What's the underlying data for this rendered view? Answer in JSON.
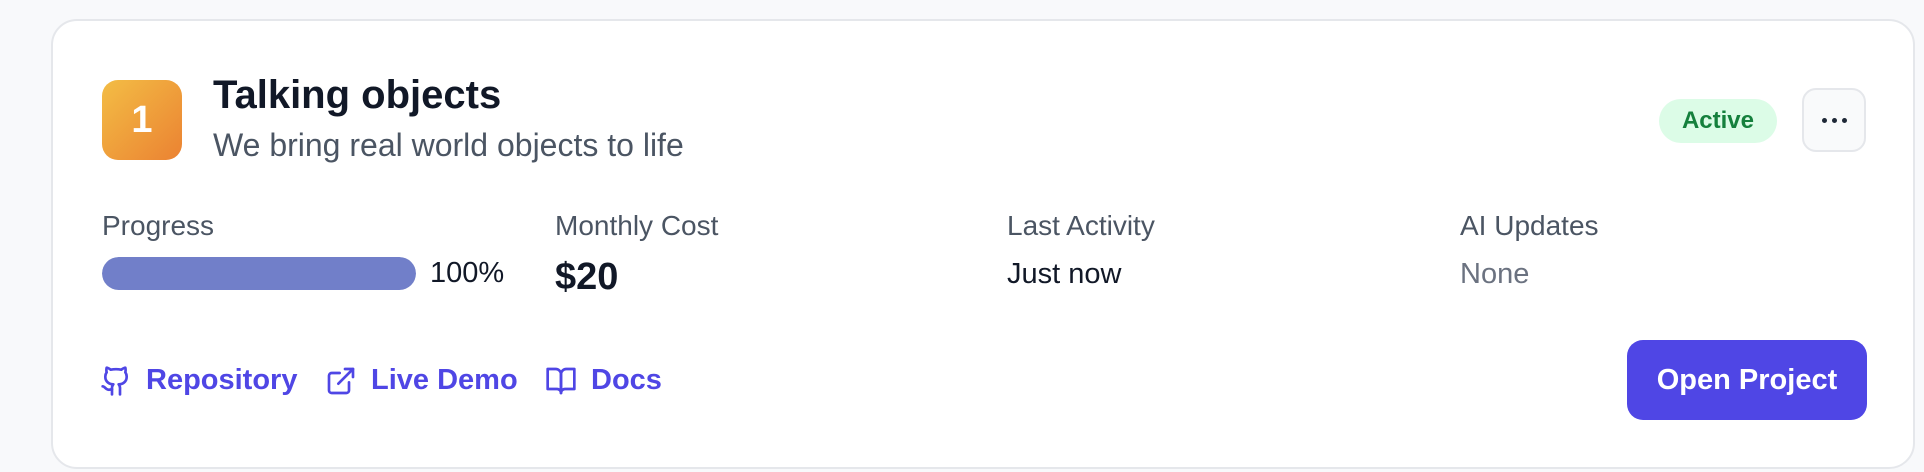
{
  "project": {
    "number": "1",
    "title": "Talking objects",
    "subtitle": "We bring real world objects to life",
    "status": "Active"
  },
  "stats": {
    "progress_label": "Progress",
    "progress_value": 1.0,
    "progress_text": "100%",
    "cost_label": "Monthly Cost",
    "cost_value": "$20",
    "activity_label": "Last Activity",
    "activity_value": "Just now",
    "ai_label": "AI Updates",
    "ai_value": "None"
  },
  "links": {
    "repository": "Repository",
    "live_demo": "Live Demo",
    "docs": "Docs"
  },
  "actions": {
    "open_project": "Open Project"
  },
  "icons": {
    "more": "more-horizontal-icon",
    "repository": "github-icon",
    "live_demo": "external-link-icon",
    "docs": "book-open-icon"
  },
  "colors": {
    "accent": "#4f46e5",
    "status_bg": "#dcfce7",
    "status_text": "#15803d",
    "progress_fill": "#717fc9",
    "badge_gradient_start": "#f3bd45",
    "badge_gradient_end": "#eb8232"
  }
}
